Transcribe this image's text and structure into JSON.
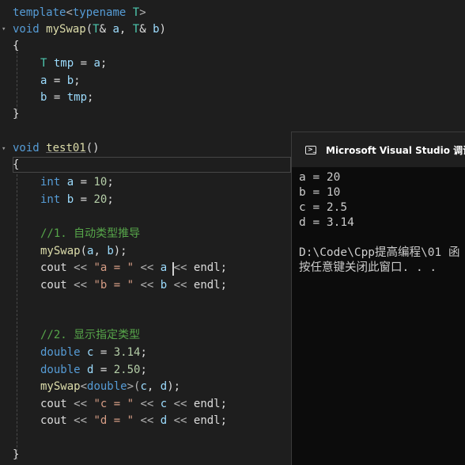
{
  "editor": {
    "code": {
      "l1_kw": "template",
      "l1_a": "<",
      "l1_kw2": "typename",
      "l1_b": " ",
      "l1_tp": "T",
      "l1_c": ">",
      "l2_kw": "void",
      "l2_sp": " ",
      "l2_fn": "mySwap",
      "l2_a": "(",
      "l2_tp1": "T",
      "l2_b": "& ",
      "l2_v1": "a",
      "l2_c": ", ",
      "l2_tp2": "T",
      "l2_d": "& ",
      "l2_v2": "b",
      "l2_e": ")",
      "l3": "{",
      "l4_tp": "T",
      "l4_sp": " ",
      "l4_v": "tmp",
      "l4_op": " = ",
      "l4_v2": "a",
      "l4_end": ";",
      "l5_v": "a",
      "l5_op": " = ",
      "l5_v2": "b",
      "l5_end": ";",
      "l6_v": "b",
      "l6_op": " = ",
      "l6_v2": "tmp",
      "l6_end": ";",
      "l7": "}",
      "l8_kw": "void",
      "l8_sp": " ",
      "l8_fn": "test01",
      "l8_p": "()",
      "l9": "{",
      "l10_kw": "int",
      "l10_sp": " ",
      "l10_v": "a",
      "l10_op": " = ",
      "l10_n": "10",
      "l10_end": ";",
      "l11_kw": "int",
      "l11_sp": " ",
      "l11_v": "b",
      "l11_op": " = ",
      "l11_n": "20",
      "l11_end": ";",
      "l12_cmt": "//1. 自动类型推导",
      "l13_fn": "mySwap",
      "l13_a": "(",
      "l13_v1": "a",
      "l13_b": ", ",
      "l13_v2": "b",
      "l13_c": ");",
      "l14_id": "cout",
      "l14_op": " << ",
      "l14_s": "\"a = \"",
      "l14_op2": " << ",
      "l14_v": "a",
      "l14_op3": " << ",
      "l14_id2": "endl",
      "l14_end": ";",
      "l15_id": "cout",
      "l15_op": " << ",
      "l15_s": "\"b = \"",
      "l15_op2": " << ",
      "l15_v": "b",
      "l15_op3": " << ",
      "l15_id2": "endl",
      "l15_end": ";",
      "l16_cmt": "//2. 显示指定类型",
      "l17_kw": "double",
      "l17_sp": " ",
      "l17_v": "c",
      "l17_op": " = ",
      "l17_n": "3.14",
      "l17_end": ";",
      "l18_kw": "double",
      "l18_sp": " ",
      "l18_v": "d",
      "l18_op": " = ",
      "l18_n": "2.50",
      "l18_end": ";",
      "l19_fn": "mySwap",
      "l19_a": "<",
      "l19_kw": "double",
      "l19_b": ">(",
      "l19_v1": "c",
      "l19_c": ", ",
      "l19_v2": "d",
      "l19_d": ");",
      "l20_id": "cout",
      "l20_op": " << ",
      "l20_s": "\"c = \"",
      "l20_op2": " << ",
      "l20_v": "c",
      "l20_op3": " << ",
      "l20_id2": "endl",
      "l20_end": ";",
      "l21_id": "cout",
      "l21_op": " << ",
      "l21_s": "\"d = \"",
      "l21_op2": " << ",
      "l21_v": "d",
      "l21_op3": " << ",
      "l21_id2": "endl",
      "l21_end": ";",
      "l22": "}"
    }
  },
  "console": {
    "title": "Microsoft Visual Studio 调试控",
    "output": [
      "a = 20",
      "b = 10",
      "c = 2.5",
      "d = 3.14",
      "D:\\Code\\Cpp提高编程\\01 函",
      "按任意键关闭此窗口. . ."
    ]
  },
  "icons": {
    "fold": "chevron-down-icon",
    "console": "console-window-icon"
  },
  "colors": {
    "editor_bg": "#1e1e1e",
    "keyword": "#569cd6",
    "type": "#4ec9b0",
    "function": "#dcdcaa",
    "variable": "#9cdcfe",
    "number": "#b5cea8",
    "string": "#d69d85",
    "comment": "#57a64a",
    "console_bg": "#0c0c0c"
  }
}
